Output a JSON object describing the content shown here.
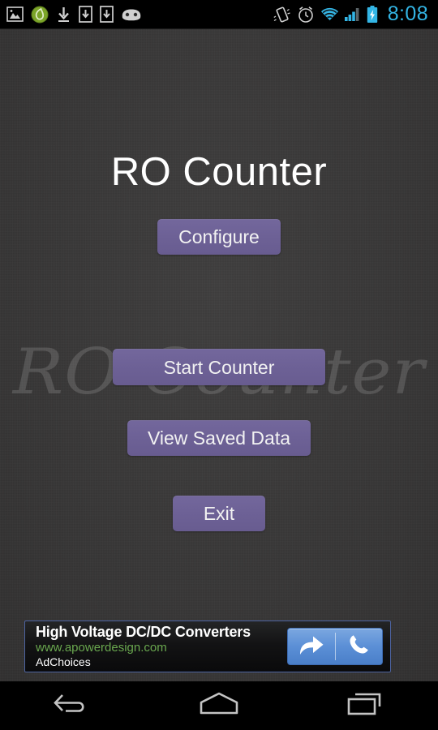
{
  "statusbar": {
    "time": "8:08",
    "left_icons": [
      {
        "name": "gallery-icon",
        "label": "Gallery"
      },
      {
        "name": "leaf-app-icon",
        "label": "Green app"
      },
      {
        "name": "download-icon",
        "label": "Download complete"
      },
      {
        "name": "download-to-device-icon",
        "label": "Download to device"
      },
      {
        "name": "download-to-device-icon-2",
        "label": "Download to device"
      },
      {
        "name": "android-head-icon",
        "label": "CyanogenMod"
      }
    ],
    "right_icons": [
      {
        "name": "vibrate-icon",
        "label": "Vibrate mode"
      },
      {
        "name": "alarm-clock-icon",
        "label": "Alarm set"
      },
      {
        "name": "wifi-icon",
        "label": "Wi-Fi"
      },
      {
        "name": "signal-bars-icon",
        "label": "Cellular signal"
      },
      {
        "name": "battery-charging-icon",
        "label": "Battery charging"
      }
    ],
    "time_color": "#33b5e5",
    "accent_color": "#33b5e5"
  },
  "app": {
    "title": "RO Counter",
    "watermark": "RO Counter",
    "background_color": "#3b3a3a",
    "button_color": "#6d6196",
    "title_color": "#ffffff"
  },
  "buttons": {
    "configure": "Configure",
    "start_counter": "Start Counter",
    "view_saved_data": "View Saved Data",
    "exit": "Exit"
  },
  "ad": {
    "headline": "High Voltage DC/DC Converters",
    "url": "www.apowerdesign.com",
    "choices": "AdChoices",
    "border_color": "#4d63a0",
    "url_color": "#6aa84f",
    "action_button_color": "#5b8fd6",
    "actions": [
      {
        "name": "ad-open-arrow-icon",
        "label": "Open"
      },
      {
        "name": "ad-call-phone-icon",
        "label": "Call"
      }
    ]
  },
  "navbar": {
    "back": "Back",
    "home": "Home",
    "recents": "Recent apps"
  }
}
